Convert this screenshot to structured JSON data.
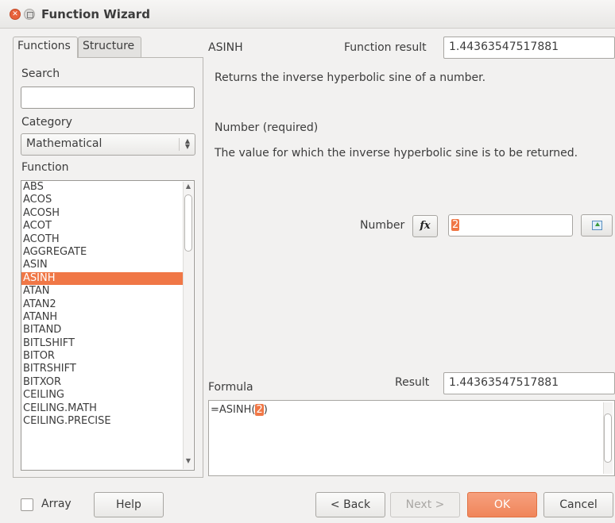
{
  "window": {
    "title": "Function Wizard"
  },
  "tabs": [
    {
      "label": "Functions",
      "active": true
    },
    {
      "label": "Structure",
      "active": false
    }
  ],
  "left": {
    "search_label": "Search",
    "search_value": "",
    "category_label": "Category",
    "category_value": "Mathematical",
    "function_label": "Function",
    "functions": [
      "ABS",
      "ACOS",
      "ACOSH",
      "ACOT",
      "ACOTH",
      "AGGREGATE",
      "ASIN",
      "ASINH",
      "ATAN",
      "ATAN2",
      "ATANH",
      "BITAND",
      "BITLSHIFT",
      "BITOR",
      "BITRSHIFT",
      "BITXOR",
      "CEILING",
      "CEILING.MATH",
      "CEILING.PRECISE"
    ],
    "selected_function": "ASINH"
  },
  "right": {
    "function_name": "ASINH",
    "function_result_label": "Function result",
    "function_result_value": "1.44363547517881",
    "description": "Returns the inverse hyperbolic sine of a number.",
    "arg_title": "Number (required)",
    "arg_description": "The value for which the inverse hyperbolic sine is to be returned.",
    "arg_label": "Number",
    "fx_label": "fx",
    "arg_value": "2",
    "formula_label": "Formula",
    "result_label": "Result",
    "result_value": "1.44363547517881",
    "formula_prefix": "=ASINH(",
    "formula_arg": "2",
    "formula_suffix": ")"
  },
  "footer": {
    "array_label": "Array",
    "array_checked": false,
    "help_label": "Help",
    "back_label": "< Back",
    "next_label": "Next >",
    "ok_label": "OK",
    "cancel_label": "Cancel"
  },
  "colors": {
    "accent": "#f07746",
    "background": "#f2f1f0"
  }
}
